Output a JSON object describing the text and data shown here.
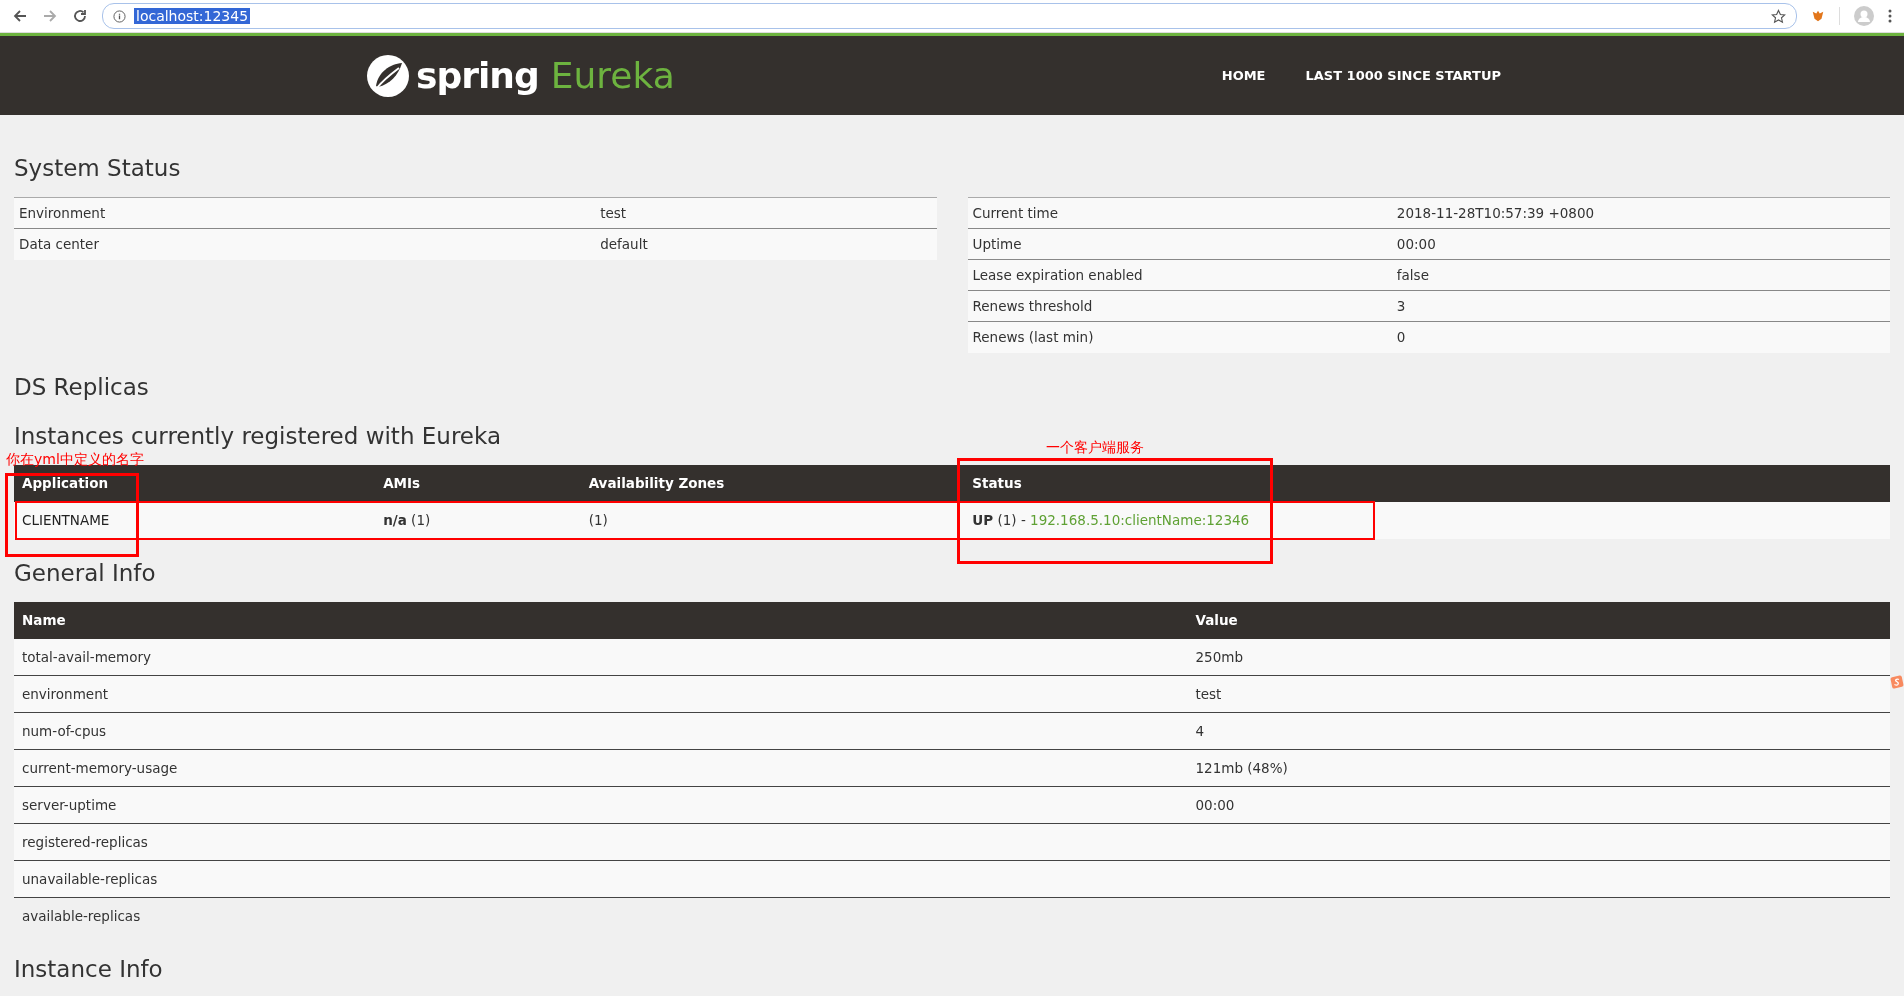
{
  "browser": {
    "url": "localhost:12345"
  },
  "navbar": {
    "brand": "spring",
    "product": "Eureka",
    "links": [
      "HOME",
      "LAST 1000 SINCE STARTUP"
    ]
  },
  "system_status": {
    "title": "System Status",
    "left": [
      {
        "label": "Environment",
        "value": "test"
      },
      {
        "label": "Data center",
        "value": "default"
      }
    ],
    "right": [
      {
        "label": "Current time",
        "value": "2018-11-28T10:57:39 +0800"
      },
      {
        "label": "Uptime",
        "value": "00:00"
      },
      {
        "label": "Lease expiration enabled",
        "value": "false"
      },
      {
        "label": "Renews threshold",
        "value": "3"
      },
      {
        "label": "Renews (last min)",
        "value": "0"
      }
    ]
  },
  "ds_replicas": {
    "title": "DS Replicas"
  },
  "instances": {
    "title": "Instances currently registered with Eureka",
    "columns": [
      "Application",
      "AMIs",
      "Availability Zones",
      "Status"
    ],
    "rows": [
      {
        "application": "CLIENTNAME",
        "amis": "**n/a** (1)",
        "zones": "(1)",
        "status": "**UP** (1) -",
        "link": "192.168.5.10:clientName:12346"
      }
    ]
  },
  "general_info": {
    "title": "General Info",
    "columns": [
      "Name",
      "Value"
    ],
    "rows": [
      {
        "name": "total-avail-memory",
        "value": "250mb"
      },
      {
        "name": "environment",
        "value": "test"
      },
      {
        "name": "num-of-cpus",
        "value": "4"
      },
      {
        "name": "current-memory-usage",
        "value": "121mb (48%)"
      },
      {
        "name": "server-uptime",
        "value": "00:00"
      },
      {
        "name": "registered-replicas",
        "value": ""
      },
      {
        "name": "unavailable-replicas",
        "value": ""
      },
      {
        "name": "available-replicas",
        "value": ""
      }
    ]
  },
  "instance_info": {
    "title": "Instance Info"
  },
  "annotations": [
    "你在yml中定义的名字",
    "一个客户端服务"
  ]
}
